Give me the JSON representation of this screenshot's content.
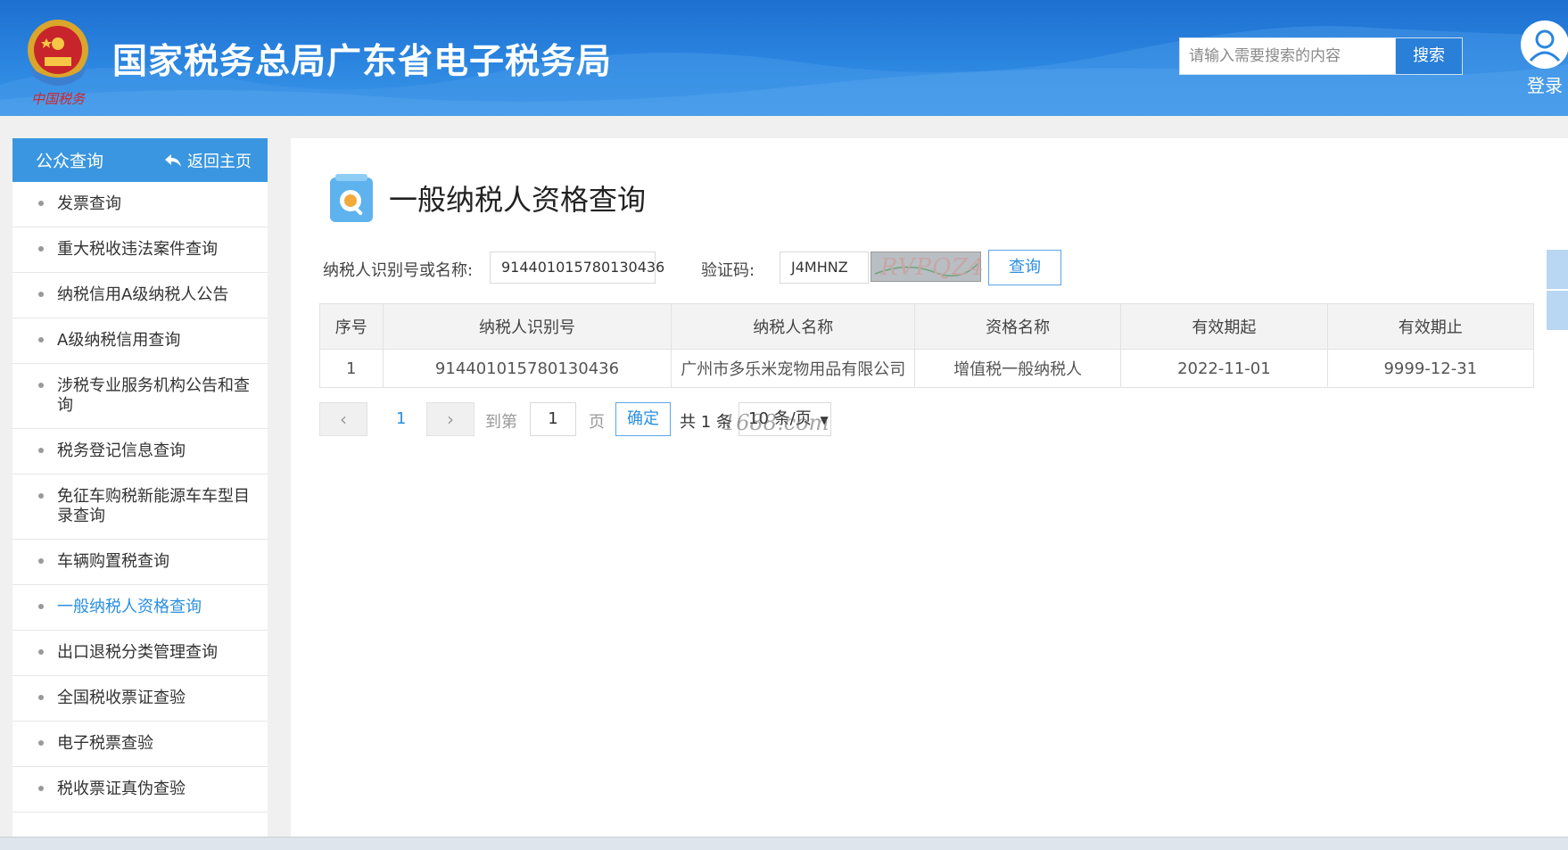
{
  "header": {
    "site_title": "国家税务总局广东省电子税务局",
    "emblem_caption": "中国税务",
    "search_placeholder": "请输入需要搜索的内容",
    "search_button": "搜索",
    "login_label": "登录"
  },
  "sidebar": {
    "title": "公众查询",
    "back_home": "返回主页",
    "items": [
      {
        "label": "发票查询"
      },
      {
        "label": "重大税收违法案件查询"
      },
      {
        "label": "纳税信用A级纳税人公告"
      },
      {
        "label": "A级纳税信用查询"
      },
      {
        "label": "涉税专业服务机构公告和查询"
      },
      {
        "label": "税务登记信息查询"
      },
      {
        "label": "免征车购税新能源车车型目录查询"
      },
      {
        "label": "车辆购置税查询"
      },
      {
        "label": "一般纳税人资格查询"
      },
      {
        "label": "出口退税分类管理查询"
      },
      {
        "label": "全国税收票证查验"
      },
      {
        "label": "电子税票查验"
      },
      {
        "label": "税收票证真伪查验"
      }
    ],
    "active_index": 8
  },
  "main": {
    "page_title": "一般纳税人资格查询",
    "form": {
      "taxpayer_label": "纳税人识别号或名称:",
      "taxpayer_value": "914401015780130436",
      "captcha_label": "验证码:",
      "captcha_value": "J4MHNZ",
      "captcha_image_text": "RVPQZ4",
      "query_button": "查询"
    },
    "table": {
      "columns": [
        "序号",
        "纳税人识别号",
        "纳税人名称",
        "资格名称",
        "有效期起",
        "有效期止"
      ],
      "rows": [
        [
          "1",
          "914401015780130436",
          "广州市多乐米宠物用品有限公司",
          "增值税一般纳税人",
          "2022-11-01",
          "9999-12-31"
        ]
      ]
    },
    "pagination": {
      "prev": "‹",
      "current_page": "1",
      "next": "›",
      "goto_label": "到第",
      "goto_value": "1",
      "page_unit": "页",
      "confirm": "确定",
      "total": "共 1 条",
      "page_size": "10 条/页"
    },
    "watermark": "1688.com"
  },
  "colors": {
    "header_blue": "#2b86e0",
    "sidebar_head": "#3a96e0",
    "accent": "#2a8fe0"
  }
}
